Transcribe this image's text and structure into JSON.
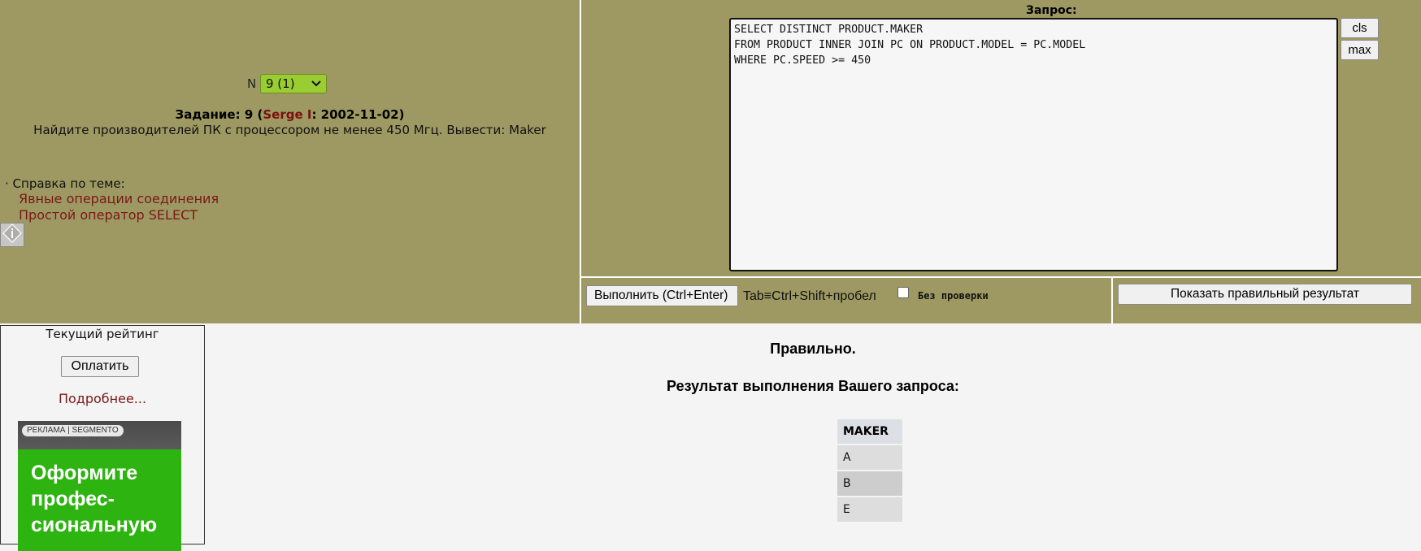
{
  "task_selector": {
    "label": "N",
    "selected": "9 (1)"
  },
  "task": {
    "prefix": "Задание: 9 (",
    "author": "Serge I",
    "suffix": ": 2002-11-02)",
    "description": "Найдите производителей ПК с процессором не менее 450 Мгц. Вывести: Maker"
  },
  "help": {
    "heading": "· Справка по теме:",
    "links": [
      "Явные операции соединения",
      "Простой оператор SELECT"
    ],
    "info_icon": "info-icon"
  },
  "query": {
    "label": "Запрос:",
    "text": "SELECT DISTINCT PRODUCT.MAKER\nFROM PRODUCT INNER JOIN PC ON PRODUCT.MODEL = PC.MODEL\nWHERE PC.SPEED >= 450",
    "cls_label": "cls",
    "max_label": "max"
  },
  "controls": {
    "execute_label": "Выполнить (Ctrl+Enter)",
    "tab_hint": "Tab≡Ctrl+Shift+пробел",
    "no_check_label": "Без проверки",
    "no_check_checked": false,
    "show_correct_label": "Показать правильный результат"
  },
  "rating": {
    "title": "Текущий рейтинг",
    "pay_label": "Оплатить",
    "more_label": "Подробнее...",
    "ad_badge": "РЕКЛАМА | SEGMENTO",
    "ad_line1": "Оформите",
    "ad_line2": "профес-",
    "ad_line3": "сиональную"
  },
  "result": {
    "status": "Правильно.",
    "heading": "Результат выполнения Вашего запроса:",
    "columns": [
      "MAKER"
    ],
    "rows": [
      "A",
      "B",
      "E"
    ]
  },
  "colors": {
    "panel": "#9e9962",
    "select": "#9acd32",
    "link": "#7a1818",
    "ad_green": "#2eb411"
  }
}
